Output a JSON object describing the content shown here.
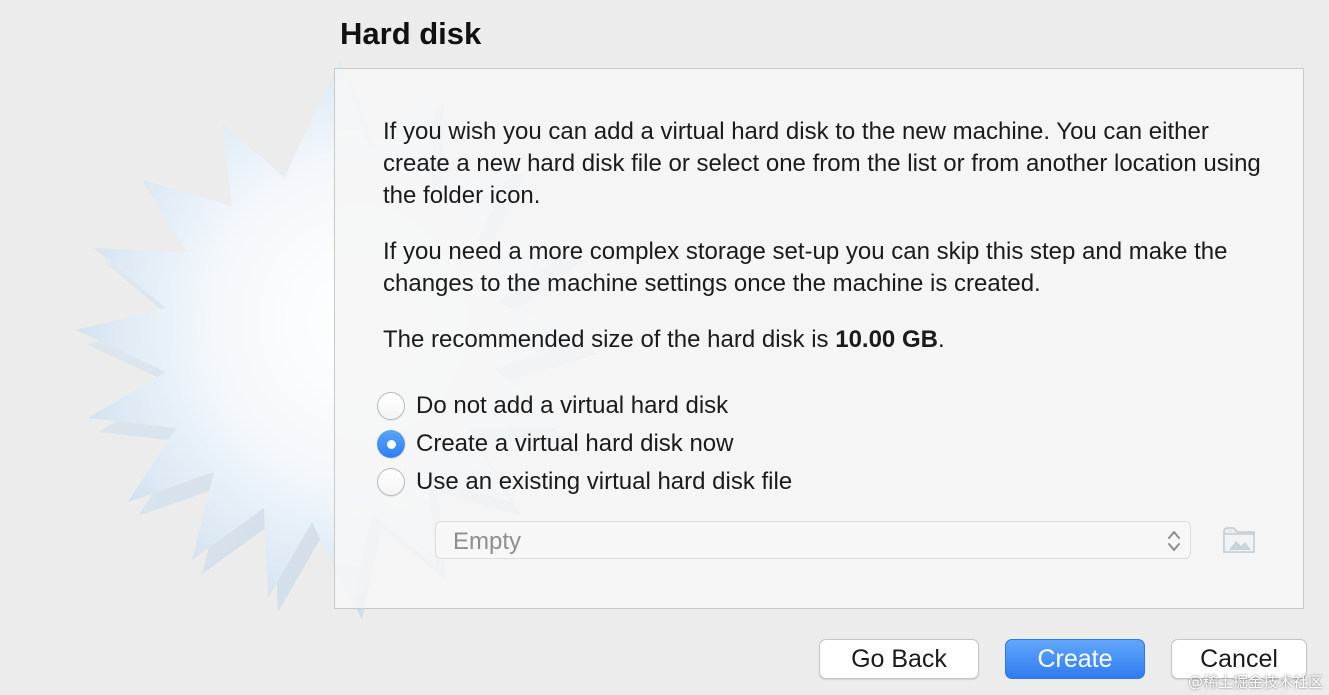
{
  "dialog": {
    "title": "Hard disk",
    "paragraphs": {
      "p1": "If you wish you can add a virtual hard disk to the new machine. You can either create a new hard disk file or select one from the list or from another location using the folder icon.",
      "p2": "If you need a more complex storage set-up you can skip this step and make the changes to the machine settings once the machine is created.",
      "p3_prefix": "The recommended size of the hard disk is ",
      "p3_value": "10.00 GB",
      "p3_suffix": "."
    },
    "options": [
      {
        "label": "Do not add a virtual hard disk",
        "selected": false
      },
      {
        "label": "Create a virtual hard disk now",
        "selected": true
      },
      {
        "label": "Use an existing virtual hard disk file",
        "selected": false
      }
    ],
    "disk_select": {
      "value": "Empty",
      "enabled": false,
      "icon": "chevron-updown-icon"
    },
    "folder_button": {
      "icon": "folder-icon",
      "enabled": false
    }
  },
  "buttons": {
    "back": "Go Back",
    "create": "Create",
    "cancel": "Cancel"
  },
  "watermark": "@稀土掘金技术社区",
  "colors": {
    "accent": "#3a86f4",
    "background": "#ececec",
    "panel": "#f6f6f6"
  }
}
